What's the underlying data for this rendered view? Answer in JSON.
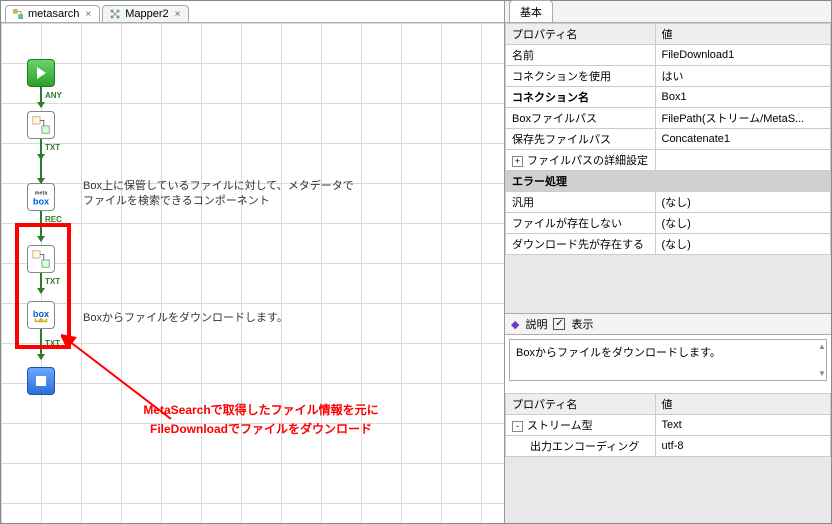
{
  "tabs": [
    {
      "label": "metasarch",
      "icon": "flow-icon"
    },
    {
      "label": "Mapper2",
      "icon": "mapper-icon"
    }
  ],
  "canvas": {
    "badges": {
      "any": "ANY",
      "txt": "TXT",
      "rec": "REC"
    },
    "comment1_line1": "Box上に保管しているファイルに対して、メタデータで",
    "comment1_line2": "ファイルを検索できるコンポーネント",
    "comment2": "Boxからファイルをダウンロードします。",
    "annotation_line1": "MetaSearchで取得したファイル情報を元に",
    "annotation_line2": "FileDownloadでファイルをダウンロード"
  },
  "props_tab": "基本",
  "props_header": {
    "name": "プロパティ名",
    "value": "値"
  },
  "props": [
    {
      "k": "名前",
      "v": "FileDownload1"
    },
    {
      "k": "コネクションを使用",
      "v": "はい"
    },
    {
      "k": "コネクション名",
      "v": "Box1",
      "bold": true
    },
    {
      "k": "Boxファイルパス",
      "v": "FilePath(ストリーム/MetaS..."
    },
    {
      "k": "保存先ファイルパス",
      "v": "Concatenate1"
    },
    {
      "k": "ファイルパスの詳細設定",
      "v": "",
      "expander": "+"
    }
  ],
  "props_section": "エラー処理",
  "props_err": [
    {
      "k": "汎用",
      "v": "(なし)"
    },
    {
      "k": "ファイルが存在しない",
      "v": "(なし)"
    },
    {
      "k": "ダウンロード先が存在する",
      "v": "(なし)"
    }
  ],
  "desc": {
    "label": "説明",
    "show": "表示",
    "body": "Boxからファイルをダウンロードします。"
  },
  "lower_props": [
    {
      "k": "ストリーム型",
      "v": "Text",
      "expander": "-"
    },
    {
      "k": "出力エンコーディング",
      "v": "utf-8",
      "indent": true
    }
  ]
}
